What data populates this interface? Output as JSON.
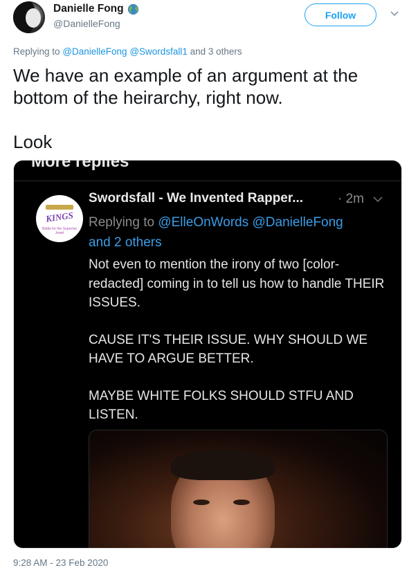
{
  "author": {
    "name": "Danielle Fong",
    "handle": "@DanielleFong",
    "badge_icon": "globe-emoji"
  },
  "follow_label": "Follow",
  "replying": {
    "prefix": "Replying to",
    "mention1": "@DanielleFong",
    "mention2": "@Swordsfall1",
    "suffix": "and 3 others"
  },
  "tweet": {
    "line1": "We have an example of an argument at the bottom of the heirarchy, right now.",
    "line2": "Look"
  },
  "media": {
    "more_replies": "More replies",
    "avatar_logo": "KINGS",
    "avatar_tagline": "Battle for the Supreme Jewel",
    "inner_name": "Swordsfall - We Invented Rapper...",
    "inner_time": "· 2m",
    "inner_replying_prefix": "Replying to",
    "inner_mention1": "@ElleOnWords",
    "inner_mention2": "@DanielleFong",
    "inner_others": "and 2 others",
    "body1": "Not even to mention the irony of two [color-redacted] coming in to tell us how to handle THEIR ISSUES.",
    "body2": "CAUSE IT'S THEIR ISSUE. WHY SHOULD WE HAVE TO ARGUE BETTER.",
    "body3": "MAYBE WHITE FOLKS SHOULD STFU AND LISTEN."
  },
  "timestamp": "9:28 AM - 23 Feb 2020",
  "colors": {
    "accent": "#1da1f2",
    "muted": "#657786",
    "dark_bg": "#000000"
  }
}
